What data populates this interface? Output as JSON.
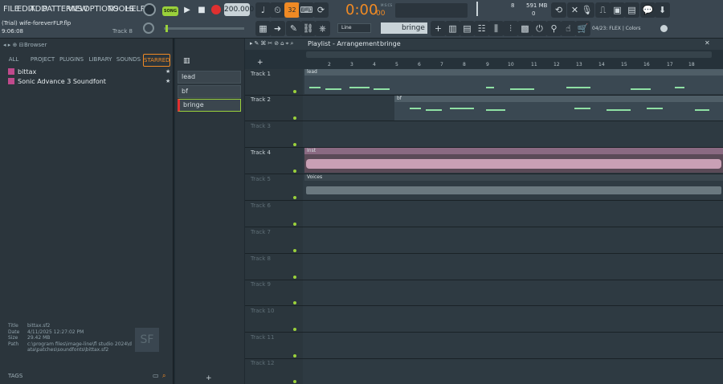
{
  "menu": [
    "FILE",
    "EDIT",
    "ADD",
    "PATTERNS",
    "VIEW",
    "OPTIONS",
    "TOOLS",
    "HELP"
  ],
  "transport": {
    "mode": "SONG",
    "tempo": "200.000",
    "time": "0:00",
    "time_ms": "00",
    "time_label": "M:S:CS"
  },
  "project": {
    "title": "(Trial) wife-foreverFLP.flp",
    "time": "9:06:08",
    "track": "Track 8"
  },
  "toolbar": {
    "snap": "Line",
    "pattern": "bringe",
    "cpu": "8",
    "mem": "591 MB",
    "voices": "0",
    "news": "04/23: FLEX | Colors",
    "step": "32"
  },
  "browser": {
    "title": "Browser",
    "tabs": [
      "ALL",
      "PROJECT",
      "PLUGINS",
      "LIBRARY",
      "SOUNDS",
      "STARRED"
    ],
    "items": [
      "bittax",
      "Sonic Advance 3 Soundfont"
    ],
    "info": {
      "labels": [
        "Title",
        "Date",
        "Size",
        "Path"
      ],
      "values": [
        "bittax.sf2",
        "4/11/2025 12:27:02 PM",
        "29.42 MB",
        "c:\\program files\\image-line\\fl studio 2024\\data\\patches\\soundfonts\\bittax.sf2"
      ]
    },
    "tags_label": "TAGS"
  },
  "patterns": [
    "lead",
    "bf",
    "bringe"
  ],
  "playlist": {
    "title": "Playlist - Arrangement",
    "crumb": "bringe",
    "ruler": [
      "2",
      "3",
      "4",
      "5",
      "6",
      "7",
      "8",
      "9",
      "10",
      "11",
      "12",
      "13",
      "14",
      "15",
      "16",
      "17",
      "18"
    ],
    "tracks": [
      "Track 1",
      "Track 2",
      "Track 3",
      "Track 4",
      "Track 5",
      "Track 6",
      "Track 7",
      "Track 8",
      "Track 9",
      "Track 10",
      "Track 11",
      "Track 12"
    ],
    "clips": [
      "lead",
      "bf",
      "Inst",
      "Voices"
    ]
  },
  "colors": {
    "accent": "#f08a24",
    "clip_pink": "#c9a0b5",
    "note_green": "#8fe0a4",
    "led": "#9ad13b",
    "rec": "#e03030"
  }
}
